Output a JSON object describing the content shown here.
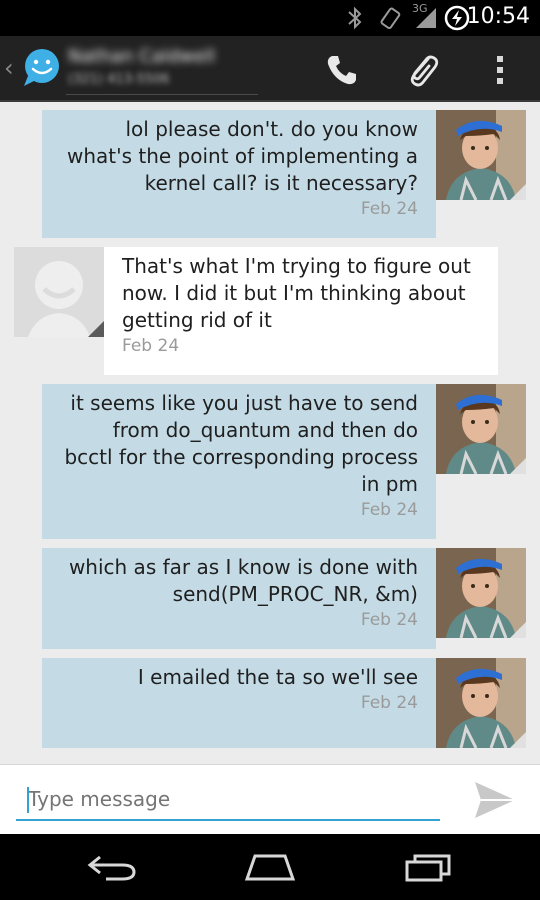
{
  "status_bar": {
    "time": "10:54",
    "network": "3G",
    "icons": [
      "bluetooth-icon",
      "vibrate-icon",
      "signal-icon",
      "battery-charging-icon"
    ]
  },
  "header": {
    "contact_name": "Nathan Caldwell",
    "contact_number": "(321) 413-5506",
    "icons": [
      "back-chevron-icon",
      "messaging-app-icon",
      "phone-icon",
      "attachment-icon",
      "overflow-menu-icon"
    ]
  },
  "messages": [
    {
      "direction": "outgoing",
      "text": "lol please don't. do you know what's the point of implementing a kernel call? is it necessary?",
      "date": "Feb 24"
    },
    {
      "direction": "incoming",
      "text": "That's what I'm trying to figure out now. I did it but I'm thinking about getting rid of it",
      "date": "Feb 24"
    },
    {
      "direction": "outgoing",
      "text": "it seems like you just have to send from do_quantum and then do bcctl for the corresponding process in pm",
      "date": "Feb 24"
    },
    {
      "direction": "outgoing",
      "text": "which as far as I know is done with send(PM_PROC_NR, &m)",
      "date": "Feb 24"
    },
    {
      "direction": "outgoing",
      "text": "I emailed the ta so we'll see",
      "date": "Feb 24"
    }
  ],
  "compose": {
    "placeholder": "Type message",
    "value": "",
    "send_icon": "send-icon"
  },
  "nav_bar": {
    "icons": [
      "back-icon",
      "home-icon",
      "recent-apps-icon"
    ]
  },
  "colors": {
    "outgoing_bubble": "#c4dbe6",
    "incoming_bubble": "#ffffff",
    "accent": "#33a1d2",
    "action_bar": "#222222",
    "background": "#ececec"
  }
}
